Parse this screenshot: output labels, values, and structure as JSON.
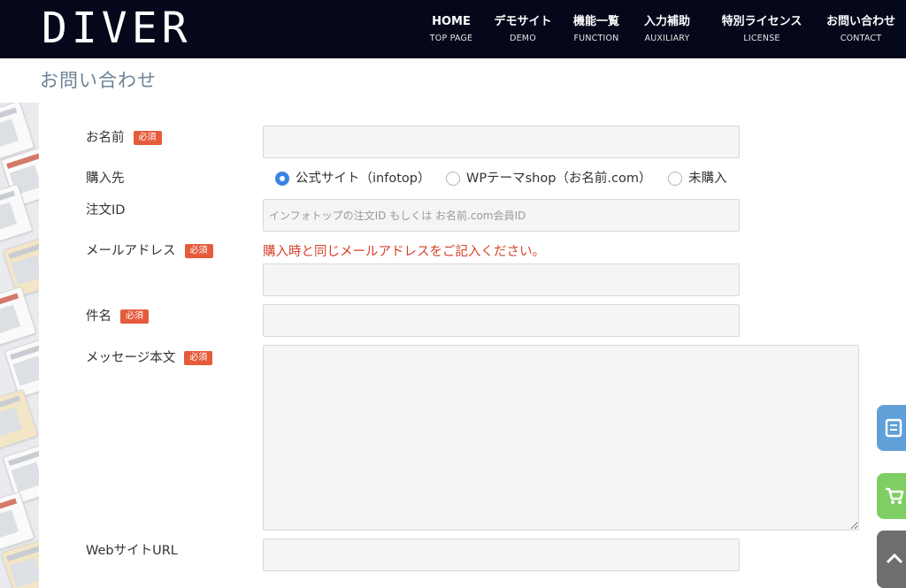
{
  "header": {
    "logo": "DIVER",
    "nav": [
      {
        "main": "HOME",
        "sub": "TOP PAGE"
      },
      {
        "main": "デモサイト",
        "sub": "DEMO"
      },
      {
        "main": "機能一覧",
        "sub": "FUNCTION"
      },
      {
        "main": "入力補助",
        "sub": "AUXILIARY"
      },
      {
        "main": "特別ライセンス",
        "sub": "LICENSE"
      },
      {
        "main": "お問い合わせ",
        "sub": "CONTACT"
      }
    ]
  },
  "page": {
    "title": "お問い合わせ"
  },
  "form": {
    "required_badge": "必須",
    "name_label": "お名前",
    "purchase_label": "購入先",
    "purchase_options": [
      {
        "label": "公式サイト（infotop）",
        "checked": true
      },
      {
        "label": "WPテーマshop（お名前.com）",
        "checked": false
      },
      {
        "label": "未購入",
        "checked": false
      }
    ],
    "order_id_label": "注文ID",
    "order_id_placeholder": "インフォトップの注文ID もしくは お名前.com会員ID",
    "email_label": "メールアドレス",
    "email_note": "購入時と同じメールアドレスをご記入ください。",
    "subject_label": "件名",
    "message_label": "メッセージ本文",
    "website_label": "WebサイトURL"
  },
  "floating_buttons": [
    {
      "icon": "document-icon",
      "color": "#5fa0d8"
    },
    {
      "icon": "cart-icon",
      "color": "#7fce63"
    },
    {
      "icon": "chevron-up-icon",
      "color": "#6e6e6e"
    }
  ]
}
